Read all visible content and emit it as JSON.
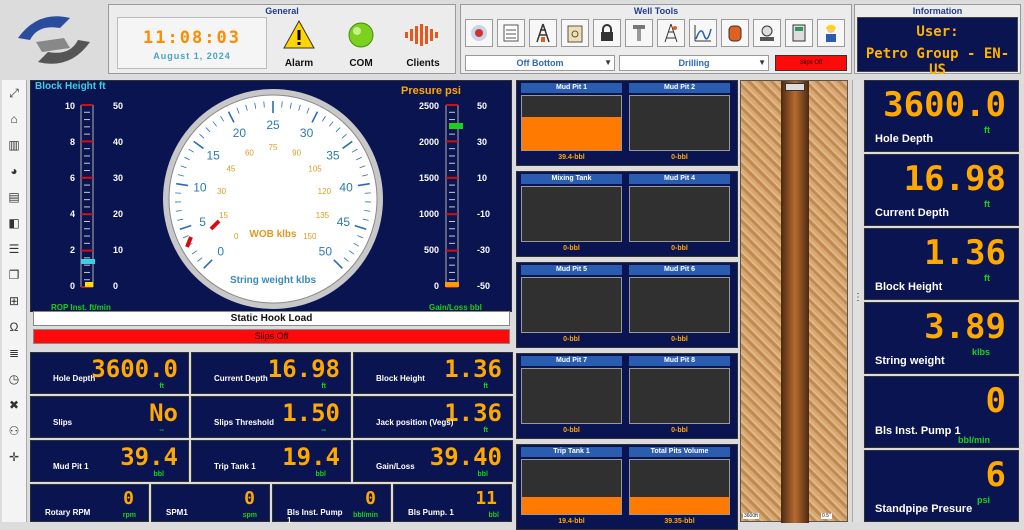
{
  "general": {
    "title": "General",
    "time": "11:08:03",
    "date": "August 1, 2024",
    "alarm": "Alarm",
    "com": "COM",
    "clients": "Clients"
  },
  "well_tools": {
    "title": "Well Tools",
    "select1": "Off Bottom",
    "select2": "Drilling",
    "slips_button": "Slips Off"
  },
  "information": {
    "title": "Information",
    "line1": "User:",
    "line2": "Petro Group - EN-US"
  },
  "gauge": {
    "block_height_title": "Block Height ft",
    "pressure_title": "Presure psi",
    "left_scale_a": [
      "10",
      "8",
      "6",
      "4",
      "2",
      "0"
    ],
    "left_scale_b": [
      "50",
      "40",
      "30",
      "20",
      "10",
      "0"
    ],
    "right_scale_a": [
      "2500",
      "2000",
      "1500",
      "1000",
      "500",
      "0"
    ],
    "right_scale_b": [
      "50",
      "30",
      "10",
      "-10",
      "-30",
      "-50"
    ],
    "dial_outer": [
      "0",
      "5",
      "10",
      "15",
      "20",
      "25",
      "30",
      "35",
      "40",
      "45",
      "50"
    ],
    "dial_inner": [
      "0",
      "15",
      "30",
      "45",
      "60",
      "75",
      "90",
      "105",
      "120",
      "135",
      "150"
    ],
    "wob_label": "WOB klbs",
    "string_label": "String weight klbs",
    "rop_label": "ROP Inst. ft/min",
    "gain_label": "Gain/Loss bbl",
    "static_hook": "Static Hook Load",
    "slips_bar": "Slips Off"
  },
  "readouts": [
    {
      "value": "3600.0",
      "label": "Hole Depth",
      "unit": "ft"
    },
    {
      "value": "16.98",
      "label": "Current Depth",
      "unit": "ft"
    },
    {
      "value": "1.36",
      "label": "Block Height",
      "unit": "ft"
    },
    {
      "value": "No",
      "label": "Slips",
      "unit": "--"
    },
    {
      "value": "1.50",
      "label": "Slips Threshold",
      "unit": "--"
    },
    {
      "value": "1.36",
      "label": "Jack position (Vegs)",
      "unit": "ft"
    },
    {
      "value": "39.4",
      "label": "Mud Pit 1",
      "unit": "bbl"
    },
    {
      "value": "19.4",
      "label": "Trip Tank 1",
      "unit": "bbl"
    },
    {
      "value": "39.40",
      "label": "Gain/Loss",
      "unit": "bbl"
    },
    {
      "value": "0",
      "label": "Rotary RPM",
      "unit": "rpm"
    },
    {
      "value": "0",
      "label": "SPM1",
      "unit": "spm"
    },
    {
      "value": "0",
      "label": "Bls Inst. Pump 1",
      "unit": "bbl/min"
    },
    {
      "value": "11",
      "label": "Bls Pump. 1",
      "unit": "bbl"
    }
  ],
  "pits": [
    {
      "name": "Mud Pit 1",
      "value": "39.4-bbl",
      "level": 0.62
    },
    {
      "name": "Mud Pit 2",
      "value": "0-bbl",
      "level": 0
    },
    {
      "name": "Mixing Tank",
      "value": "0-bbl",
      "level": 0
    },
    {
      "name": "Mud Pit 4",
      "value": "0-bbl",
      "level": 0
    },
    {
      "name": "Mud Pit 5",
      "value": "0-bbl",
      "level": 0
    },
    {
      "name": "Mud Pit 6",
      "value": "0-bbl",
      "level": 0
    },
    {
      "name": "Mud Pit 7",
      "value": "0-bbl",
      "level": 0
    },
    {
      "name": "Mud Pit 8",
      "value": "0-bbl",
      "level": 0
    },
    {
      "name": "Trip Tank 1",
      "value": "19.4-bbl",
      "level": 0.32
    },
    {
      "name": "Total Pits Volume",
      "value": "39.35-bbl",
      "level": 0.32
    }
  ],
  "well": {
    "bottom_left": "3600ft",
    "bottom_right": "0.5\""
  },
  "right_panel": [
    {
      "value": "3600.0",
      "label": "Hole Depth",
      "unit": "ft"
    },
    {
      "value": "16.98",
      "label": "Current Depth",
      "unit": "ft"
    },
    {
      "value": "1.36",
      "label": "Block Height",
      "unit": "ft"
    },
    {
      "value": "3.89",
      "label": "String weight",
      "unit": "klbs"
    },
    {
      "value": "0",
      "label": "Bls Inst. Pump 1",
      "unit": "bbl/min"
    },
    {
      "value": "6",
      "label": "Standpipe Presure",
      "unit": "psi"
    }
  ]
}
